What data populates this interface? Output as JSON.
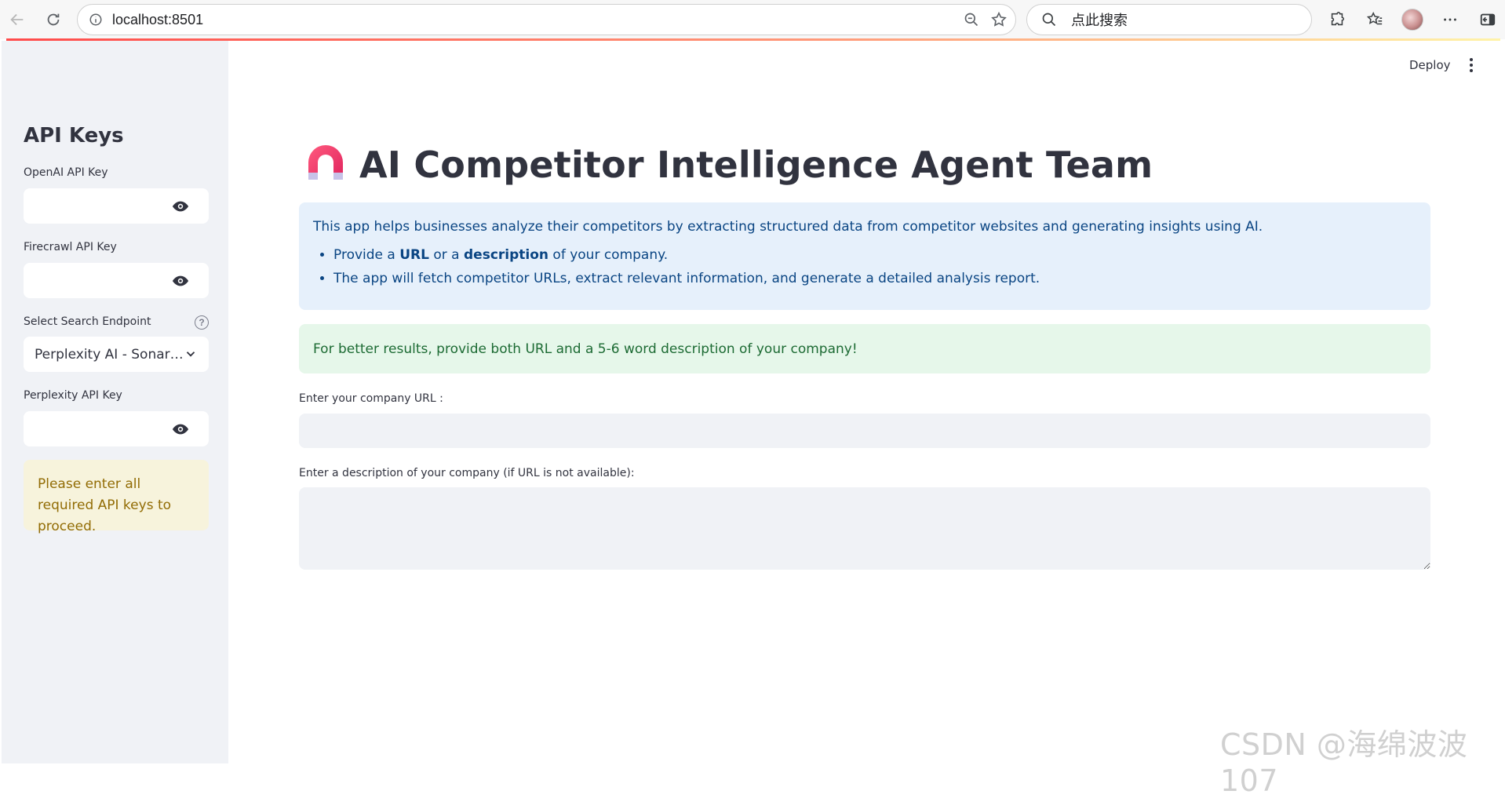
{
  "browser": {
    "url": "localhost:8501",
    "search_text": "点此搜索"
  },
  "sidebar": {
    "title": "API Keys",
    "openai_label": "OpenAI API Key",
    "firecrawl_label": "Firecrawl API Key",
    "endpoint_label": "Select Search Endpoint",
    "endpoint_selected": "Perplexity AI - Sonar…",
    "perplexity_label": "Perplexity API Key",
    "warning": "Please enter all required API keys to proceed."
  },
  "header": {
    "deploy_label": "Deploy"
  },
  "main": {
    "title": "AI Competitor Intelligence Agent Team",
    "info_intro": "This app helps businesses analyze their competitors by extracting structured data from competitor websites and generating insights using AI.",
    "bullet1_a": "Provide a ",
    "bullet1_b": "URL",
    "bullet1_c": " or a ",
    "bullet1_d": "description",
    "bullet1_e": " of your company.",
    "bullet2": "The app will fetch competitor URLs, extract relevant information, and generate a detailed analysis report.",
    "success": "For better results, provide both URL and a 5-6 word description of your company!",
    "url_label": "Enter your company URL :",
    "url_value": "",
    "desc_label": "Enter a description of your company (if URL is not available):",
    "desc_value": ""
  },
  "watermark": "CSDN @海绵波波107",
  "colors": {
    "sidebar_bg": "#f0f2f6",
    "info_bg": "#e6f0fb",
    "info_text": "#0a4583",
    "success_bg": "#e6f7ea",
    "success_text": "#1d6b34",
    "warning_bg": "#f7f3dc",
    "warning_text": "#926c05"
  }
}
